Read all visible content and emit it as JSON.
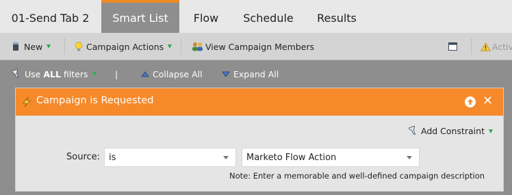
{
  "tabs": [
    {
      "label": "01-Send Tab 2"
    },
    {
      "label": "Smart List"
    },
    {
      "label": "Flow"
    },
    {
      "label": "Schedule"
    },
    {
      "label": "Results"
    }
  ],
  "active_tab": "Smart List",
  "toolbar": {
    "new_label": "New",
    "campaign_actions_label": "Campaign Actions",
    "view_members_label": "View Campaign Members",
    "activation_label": "Activ"
  },
  "filterbar": {
    "use_filters_prefix": "Use ",
    "use_filters_all": "ALL",
    "use_filters_suffix": " filters",
    "divider": "|",
    "collapse_label": "Collapse All",
    "expand_label": "Expand All"
  },
  "trigger": {
    "title": "Campaign is Requested",
    "add_constraint_label": "Add Constraint",
    "source_label": "Source:",
    "operator_value": "is",
    "source_value": "Marketo Flow Action",
    "note": "Note: Enter a memorable and well-defined campaign description"
  },
  "colors": {
    "accent": "#f6892a",
    "dropdown_triangle": "#34a853",
    "toolbar_bg": "#d4d4d4",
    "tab_active_bg": "#8e8e8e"
  }
}
